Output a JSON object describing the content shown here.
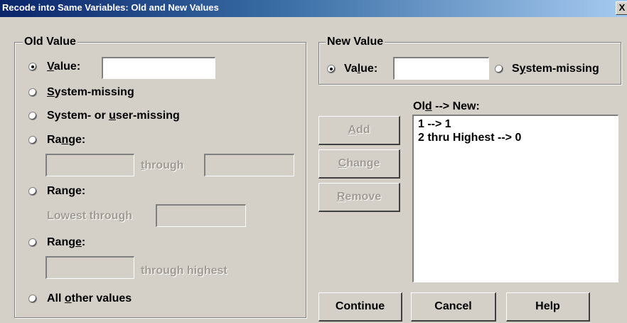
{
  "window": {
    "title": "Recode into Same Variables: Old and New Values",
    "close_glyph": "X"
  },
  "old_value": {
    "group_label": "Old Value",
    "value_radio": {
      "pre": "",
      "key": "V",
      "post": "alue:",
      "selected": true,
      "input_value": ""
    },
    "system_missing": {
      "pre": "",
      "key": "S",
      "post": "ystem-missing",
      "selected": false
    },
    "system_or_user_missing": {
      "pre": "System- or ",
      "key": "u",
      "post": "ser-missing",
      "selected": false
    },
    "range1": {
      "pre": "Ra",
      "key": "n",
      "post": "ge:",
      "selected": false,
      "through_pre": "",
      "through_key": "t",
      "through_post": "hrough",
      "from_value": "",
      "to_value": ""
    },
    "range2": {
      "label": "Range:",
      "selected": false,
      "lowest_through": "Lowest through",
      "value": ""
    },
    "range3": {
      "pre": "Rang",
      "key": "e",
      "post": ":",
      "selected": false,
      "through_highest": "through highest",
      "value": ""
    },
    "all_other": {
      "pre": "All ",
      "key": "o",
      "post": "ther values",
      "selected": false
    }
  },
  "new_value": {
    "group_label": "New Value",
    "value_radio": {
      "pre": "Va",
      "key": "l",
      "post": "ue:",
      "selected": true,
      "input_value": ""
    },
    "system_missing": {
      "pre": "S",
      "key": "y",
      "post": "stem-missing",
      "selected": false
    }
  },
  "mapping": {
    "label_pre": "Ol",
    "label_key": "d",
    "label_post": " --> New:",
    "items": [
      "1 --> 1",
      "2 thru Highest --> 0"
    ]
  },
  "buttons": {
    "add": {
      "key": "A",
      "post": "dd",
      "enabled": false
    },
    "change": {
      "key": "C",
      "post": "hange",
      "enabled": false
    },
    "remove": {
      "key": "R",
      "post": "emove",
      "enabled": false
    },
    "continue": "Continue",
    "cancel": "Cancel",
    "help": "Help"
  },
  "colors": {
    "titlebar_start": "#0a246a",
    "titlebar_end": "#a6caf0",
    "face": "#d4d0c8"
  }
}
